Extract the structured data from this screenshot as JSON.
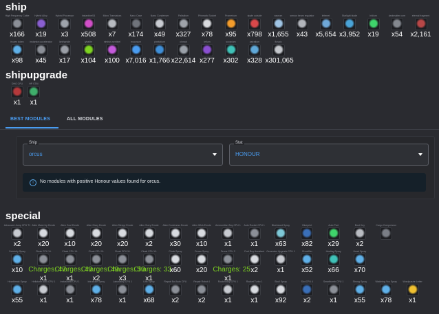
{
  "ship": {
    "title": "ship",
    "rows": [
      [
        {
          "name": "High Frequency Cable",
          "count": "x166",
          "color": "#8b8f97"
        },
        {
          "name": "Hybrid Alloy",
          "count": "x19",
          "color": "#8a5fd1"
        },
        {
          "name": "Hybrid Processor",
          "count": "x3",
          "color": "#9ea3ab"
        },
        {
          "name": "InstantineS4",
          "count": "x508",
          "color": "#d24fc8"
        },
        {
          "name": "Micro Transistors",
          "count": "x7",
          "color": "#b7bac0"
        },
        {
          "name": "Nano Case",
          "count": "x174",
          "color": "#6f737b"
        },
        {
          "name": "Nano Condenser",
          "count": "x49",
          "color": "#c9ccd2"
        },
        {
          "name": "Palladium",
          "count": "x327",
          "color": "#9fa3aa"
        },
        {
          "name": "Prismatic Socket",
          "count": "x78",
          "color": "#d8dade"
        },
        {
          "name": "Promerium",
          "count": "x95",
          "color": "#f39c2b"
        },
        {
          "name": "ripple outside",
          "count": "x798",
          "color": "#d9484a"
        },
        {
          "name": "seprom",
          "count": "x1,655",
          "color": "#9fc4e4"
        },
        {
          "name": "sensor beam regulator",
          "count": "x43",
          "color": "#b2b5bb"
        },
        {
          "name": "lefemet",
          "count": "x5,654",
          "color": "#6fa8d8"
        },
        {
          "name": "Starlight blade",
          "count": "x3,952",
          "color": "#4aa4d8"
        },
        {
          "name": "Iridium",
          "count": "x19",
          "color": "#3fd46b"
        },
        {
          "name": "darkmatter core",
          "count": "x54",
          "color": "#84888f"
        },
        {
          "name": "eternal fragment",
          "count": "x2,161",
          "color": "#b84747"
        }
      ],
      [
        {
          "name": "frozen token",
          "count": "x98",
          "color": "#5fb0e8"
        },
        {
          "name": "instanton accelerator",
          "count": "x45",
          "color": "#8b8f97"
        },
        {
          "name": "lanthanide",
          "count": "x17",
          "color": "#9a9ea6"
        },
        {
          "name": "lybatite",
          "count": "x104",
          "color": "#7ed321"
        },
        {
          "name": "nimbus sentinel",
          "count": "x100",
          "color": "#c45adb"
        },
        {
          "name": "mucosum",
          "count": "x7,016",
          "color": "#4a9cf0"
        },
        {
          "name": "pixelatium",
          "count": "x1,766",
          "color": "#3f8fd8"
        },
        {
          "name": "cinnab",
          "count": "x22,614",
          "color": "#9aa0a8"
        },
        {
          "name": "lefium",
          "count": "x277",
          "color": "#8a4fd1"
        },
        {
          "name": "scorpium",
          "count": "x302",
          "color": "#3fc2b8"
        },
        {
          "name": "astratium",
          "count": "x328",
          "color": "#5fa8d8"
        },
        {
          "name": "fiosaic",
          "count": "x301,065",
          "color": "#c4c7cc"
        }
      ]
    ]
  },
  "shipupgrade": {
    "title": "shipupgrade",
    "items": [
      {
        "name": "DHG CPU",
        "count": "x1",
        "color": "#b4393b"
      },
      {
        "name": "HP STM",
        "count": "x1",
        "color": "#3fae6b"
      }
    ]
  },
  "tabs": [
    {
      "label": "BEST MODULES",
      "active": true
    },
    {
      "label": "ALL MODULES",
      "active": false
    }
  ],
  "filters": {
    "ship": {
      "label": "Ship",
      "value": "orcus"
    },
    "stat": {
      "label": "Stat",
      "value": "HONOUR"
    },
    "alert": "No modules with positive Honour values found for orcus.",
    "alert_icon": "info-icon"
  },
  "special": {
    "title": "special",
    "rows": [
      [
        {
          "name": "Advanced Jump CPU T1",
          "count": "x2",
          "color": "#c8cbd1"
        },
        {
          "name": "Alien Mask Lip Emote",
          "count": "x20",
          "color": "#d8dbe0"
        },
        {
          "name": "Alien Cool Emote",
          "count": "x10",
          "color": "#d8dbe0"
        },
        {
          "name": "Alien Dizzy Emote",
          "count": "x20",
          "color": "#d8dbe0"
        },
        {
          "name": "Alien Sleepy Emote",
          "count": "x20",
          "color": "#d8dbe0"
        },
        {
          "name": "Alien Sorry Emote",
          "count": "x2",
          "color": "#d8dbe0"
        },
        {
          "name": "Alien Dumbness Emote",
          "count": "x30",
          "color": "#d8dbe0"
        },
        {
          "name": "Alien Wink Emote",
          "count": "x10",
          "color": "#d8dbe0"
        },
        {
          "name": "Ammunition Buy CPU 1",
          "count": "x1",
          "color": "#c8cbd1"
        },
        {
          "name": "Auto Rocket CPU 1",
          "count": "x1",
          "color": "#8b8f97"
        },
        {
          "name": "Bluebeard Spray",
          "count": "x63",
          "color": "#7ec9d8"
        },
        {
          "name": "Blueprint",
          "count": "x82",
          "color": "#3a6fb8"
        },
        {
          "name": "Auto Part",
          "count": "x29",
          "color": "#3fd46b"
        },
        {
          "name": "Boot Key",
          "count": "x2",
          "color": "#b9bcc2"
        },
        {
          "name": "Cargo Compressor",
          "count": "",
          "color": "#7a7e86"
        }
      ],
      [
        {
          "name": "Celebrity Spray",
          "count": "x10",
          "color": "#5fb0e8"
        },
        {
          "name": "Cloak CPU XL",
          "count": "x1",
          "charges": "Charges: 47",
          "color": "#8b8f97"
        },
        {
          "name": "Cloak CPU XL",
          "count": "x1",
          "charges": "Charges: 40",
          "color": "#8b8f97"
        },
        {
          "name": "Cloak CPU XL",
          "count": "x2",
          "charges": "Charges: 49",
          "color": "#8b8f97"
        },
        {
          "name": "Cloak CPU XL",
          "count": "x3",
          "charges": "Charges: 50",
          "color": "#8b8f97"
        },
        {
          "name": "Cloak CPU XL",
          "count": "x1",
          "charges": "Charges: 33",
          "color": "#8b8f97"
        },
        {
          "name": "Cloak Spray",
          "count": "x60",
          "color": "#d8dbe0"
        },
        {
          "name": "Crown Spray",
          "count": "x20",
          "color": "#d8dbe0"
        },
        {
          "name": "Drone CPU 2",
          "count": "x1",
          "charges": "Charges: 25",
          "color": "#8b8f97"
        },
        {
          "name": "Fuel Buy Assistant",
          "count": "x2",
          "color": "#d8dbe0"
        },
        {
          "name": "Generator Upgrade CPU 1",
          "count": "x1",
          "color": "#c8cbd1"
        },
        {
          "name": "Ghostflier",
          "count": "x52",
          "color": "#5fb0e8"
        },
        {
          "name": "Healing Spray",
          "count": "x66",
          "color": "#3fc2b8"
        },
        {
          "name": "Heart Spray",
          "count": "x70",
          "color": "#5fb0e8"
        }
      ],
      [
        {
          "name": "Heartbreak Spray",
          "count": "x55",
          "color": "#5fb0e8"
        },
        {
          "name": "Hellstorm Auto CPU 1",
          "count": "x1",
          "color": "#c8cbd1"
        },
        {
          "name": "Instashield CPU 1",
          "count": "x1",
          "color": "#8b8f97"
        },
        {
          "name": "Introduce Spray",
          "count": "x78",
          "color": "#5fb0e8"
        },
        {
          "name": "Laboratory CPU 1",
          "count": "x1",
          "color": "#8b8f97"
        },
        {
          "name": "Link Spray",
          "count": "x68",
          "color": "#5fb0e8"
        },
        {
          "name": "Repair Bot Auto CPU",
          "count": "x2",
          "color": "#8b8f97"
        },
        {
          "name": "Repair Robot 4",
          "count": "x2",
          "color": "#8b8f97"
        },
        {
          "name": "Rocket Buy CPU 1",
          "count": "x1",
          "color": "#c8cbd1"
        },
        {
          "name": "Rocket Turbo 1",
          "count": "x1",
          "color": "#d8dbe0"
        },
        {
          "name": "Skull Spray",
          "count": "x92",
          "color": "#d8dbe0"
        },
        {
          "name": "Slot CPU 4",
          "count": "x2",
          "color": "#3a6fb8"
        },
        {
          "name": "Smartbomb CPU 1",
          "count": "x1",
          "color": "#8b8f97"
        },
        {
          "name": "Strong Spray",
          "count": "x55",
          "color": "#5fb0e8"
        },
        {
          "name": "Watching You Spray",
          "count": "x78",
          "color": "#5fb0e8"
        },
        {
          "name": "Wordpuzzle Letter",
          "count": "x1",
          "color": "#f0c030"
        }
      ]
    ]
  }
}
